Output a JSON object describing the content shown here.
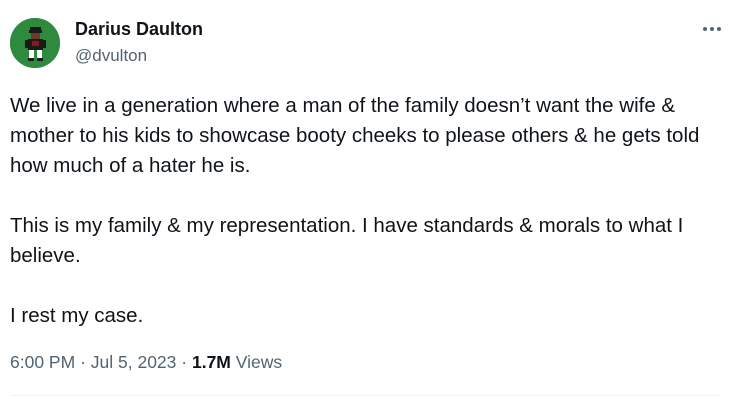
{
  "author": {
    "display_name": "Darius Daulton",
    "handle": "@dvulton"
  },
  "tweet": {
    "paragraphs": [
      "We live in a generation where a man of the family doesn’t want the wife & mother to his kids to showcase booty cheeks to please others & he gets told how much of a hater he is.",
      "This is my family & my representation. I have standards & morals to what I believe.",
      "I rest my case."
    ]
  },
  "meta": {
    "time": "6:00 PM",
    "separator": "·",
    "date": "Jul 5, 2023",
    "views_count": "1.7M",
    "views_label": "Views"
  },
  "icons": {
    "avatar": "avatar-image",
    "more": "more-horizontal-icon"
  },
  "colors": {
    "text_primary": "#0f1419",
    "text_secondary": "#536471",
    "avatar_bg": "#2e8a3c",
    "divider": "#eff3f4"
  }
}
